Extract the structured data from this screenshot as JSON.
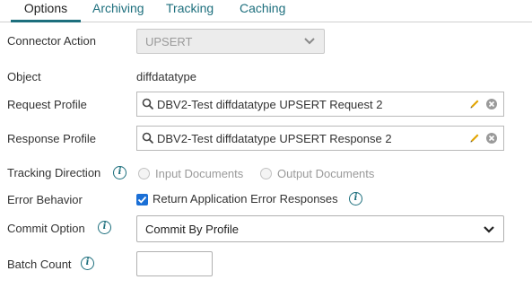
{
  "tabs": [
    {
      "label": "Options",
      "active": true
    },
    {
      "label": "Archiving",
      "active": false
    },
    {
      "label": "Tracking",
      "active": false
    },
    {
      "label": "Caching",
      "active": false
    }
  ],
  "connector_action": {
    "label": "Connector Action",
    "value": "UPSERT",
    "disabled": true
  },
  "object": {
    "label": "Object",
    "value": "diffdatatype"
  },
  "request_profile": {
    "label": "Request Profile",
    "value": "DBV2-Test diffdatatype UPSERT Request 2"
  },
  "response_profile": {
    "label": "Response Profile",
    "value": "DBV2-Test diffdatatype UPSERT Response 2"
  },
  "tracking_direction": {
    "label": "Tracking Direction",
    "options": [
      "Input Documents",
      "Output Documents"
    ],
    "selected": "Input Documents",
    "disabled": true
  },
  "error_behavior": {
    "label": "Error Behavior",
    "checkbox_label": "Return Application Error Responses",
    "checked": true
  },
  "commit_option": {
    "label": "Commit Option",
    "value": "Commit By Profile"
  },
  "batch_count": {
    "label": "Batch Count",
    "value": ""
  },
  "colors": {
    "accent": "#1d6f7d",
    "checkbox": "#1a6fd6",
    "pencil": "#e2a400"
  }
}
